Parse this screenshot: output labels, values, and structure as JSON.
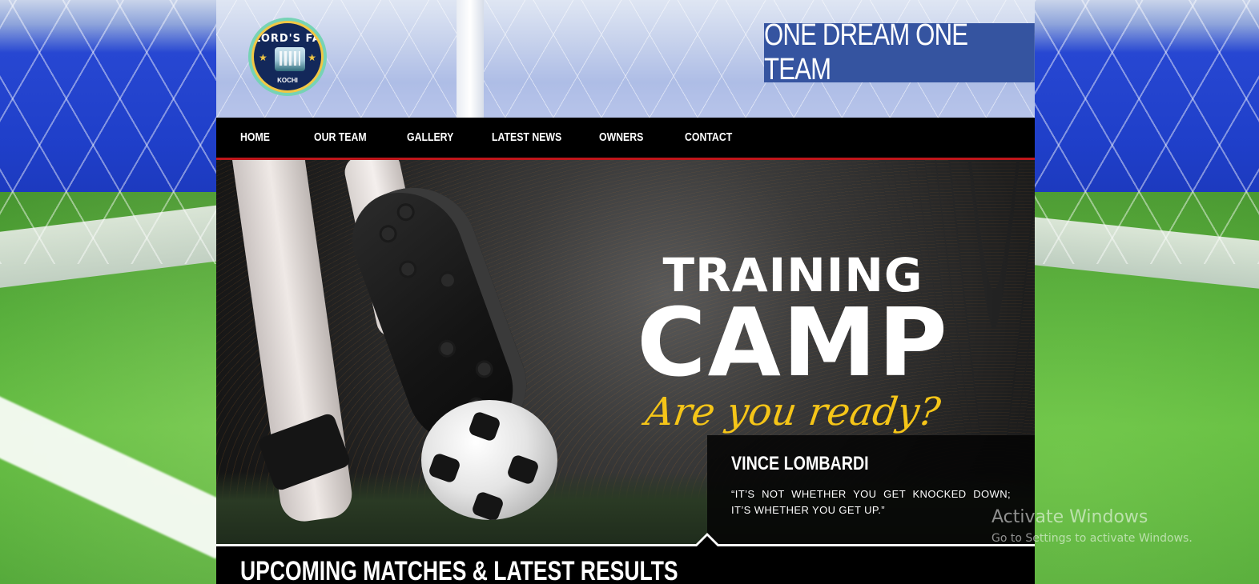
{
  "site": {
    "logo": {
      "top_text": "LORD'S FA",
      "bottom_text": "KOCHI",
      "colors": {
        "ring": "#76d3b5",
        "inner": "#13285a",
        "accent": "#f2c744"
      }
    },
    "tagline": "ONE DREAM ONE TEAM",
    "tagline_bg": "#3554a0"
  },
  "nav": {
    "items": [
      {
        "label": "HOME"
      },
      {
        "label": "OUR TEAM"
      },
      {
        "label": "GALLERY"
      },
      {
        "label": "LATEST NEWS"
      },
      {
        "label": "OWNERS"
      },
      {
        "label": "CONTACT"
      }
    ],
    "accent": "#c0161b"
  },
  "hero": {
    "promo": {
      "line1": "TRAINING",
      "line2": "CAMP",
      "line3": "Are you ready?"
    },
    "quote": {
      "author": "VINCE LOMBARDI",
      "text": "“IT’S NOT WHETHER YOU GET KNOCKED DOWN; IT’S WHETHER YOU GET UP.”"
    }
  },
  "section": {
    "title": "UPCOMING MATCHES & LATEST RESULTS"
  },
  "watermark": {
    "title": "Activate Windows",
    "subtitle": "Go to Settings to activate Windows."
  }
}
